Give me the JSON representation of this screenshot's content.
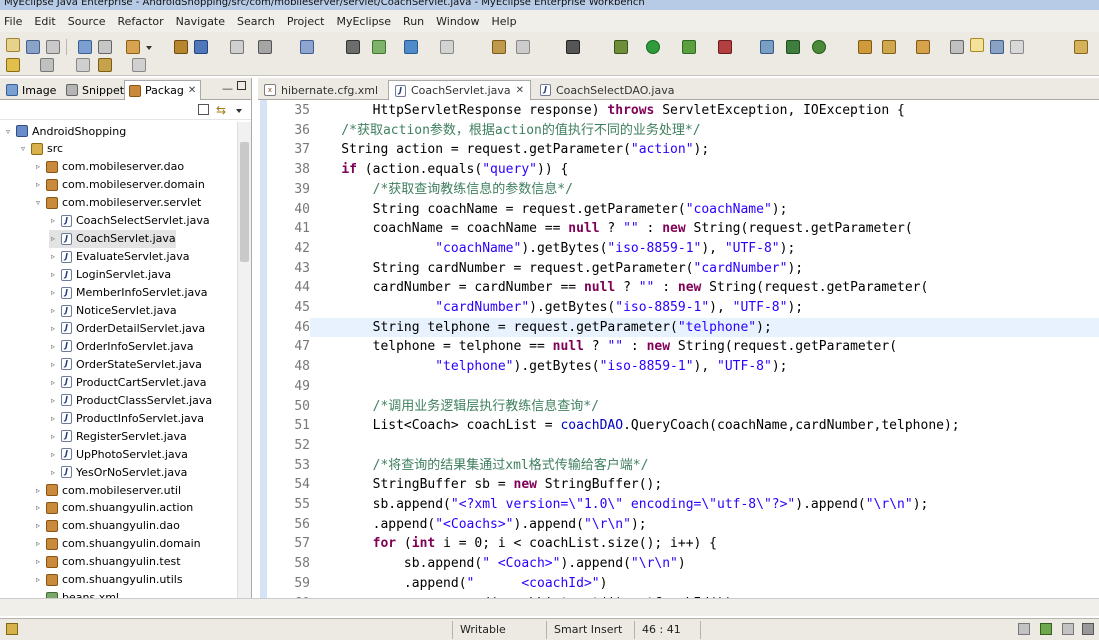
{
  "window": {
    "title": "MyEclipse Java Enterprise - AndroidShopping/src/com/mobileserver/servlet/CoachServlet.java - MyEclipse Enterprise Workbench"
  },
  "menu": [
    "File",
    "Edit",
    "Source",
    "Refactor",
    "Navigate",
    "Search",
    "Project",
    "MyEclipse",
    "Run",
    "Window",
    "Help"
  ],
  "left_tabs": [
    {
      "label": "Image",
      "icon": "image-icon"
    },
    {
      "label": "Snippet",
      "icon": "snippet-icon"
    },
    {
      "label": "Packag",
      "icon": "package-explorer-icon"
    }
  ],
  "tree": [
    {
      "label": "AndroidShopping",
      "kind": "project",
      "indent": 0,
      "twisty": "▿"
    },
    {
      "label": "src",
      "kind": "src",
      "indent": 1,
      "twisty": "▿"
    },
    {
      "label": "com.mobileserver.dao",
      "kind": "pkg",
      "indent": 2,
      "twisty": "▹"
    },
    {
      "label": "com.mobileserver.domain",
      "kind": "pkg",
      "indent": 2,
      "twisty": "▹"
    },
    {
      "label": "com.mobileserver.servlet",
      "kind": "pkg",
      "indent": 2,
      "twisty": "▿"
    },
    {
      "label": "CoachSelectServlet.java",
      "kind": "java",
      "indent": 3,
      "twisty": "▹"
    },
    {
      "label": "CoachServlet.java",
      "kind": "java",
      "indent": 3,
      "twisty": "▹",
      "selected": true
    },
    {
      "label": "EvaluateServlet.java",
      "kind": "java",
      "indent": 3,
      "twisty": "▹"
    },
    {
      "label": "LoginServlet.java",
      "kind": "java",
      "indent": 3,
      "twisty": "▹"
    },
    {
      "label": "MemberInfoServlet.java",
      "kind": "java",
      "indent": 3,
      "twisty": "▹"
    },
    {
      "label": "NoticeServlet.java",
      "kind": "java",
      "indent": 3,
      "twisty": "▹"
    },
    {
      "label": "OrderDetailServlet.java",
      "kind": "java",
      "indent": 3,
      "twisty": "▹"
    },
    {
      "label": "OrderInfoServlet.java",
      "kind": "java",
      "indent": 3,
      "twisty": "▹"
    },
    {
      "label": "OrderStateServlet.java",
      "kind": "java",
      "indent": 3,
      "twisty": "▹"
    },
    {
      "label": "ProductCartServlet.java",
      "kind": "java",
      "indent": 3,
      "twisty": "▹"
    },
    {
      "label": "ProductClassServlet.java",
      "kind": "java",
      "indent": 3,
      "twisty": "▹"
    },
    {
      "label": "ProductInfoServlet.java",
      "kind": "java",
      "indent": 3,
      "twisty": "▹"
    },
    {
      "label": "RegisterServlet.java",
      "kind": "java",
      "indent": 3,
      "twisty": "▹"
    },
    {
      "label": "UpPhotoServlet.java",
      "kind": "java",
      "indent": 3,
      "twisty": "▹"
    },
    {
      "label": "YesOrNoServlet.java",
      "kind": "java",
      "indent": 3,
      "twisty": "▹"
    },
    {
      "label": "com.mobileserver.util",
      "kind": "pkg",
      "indent": 2,
      "twisty": "▹"
    },
    {
      "label": "com.shuangyulin.action",
      "kind": "pkg",
      "indent": 2,
      "twisty": "▹"
    },
    {
      "label": "com.shuangyulin.dao",
      "kind": "pkg",
      "indent": 2,
      "twisty": "▹"
    },
    {
      "label": "com.shuangyulin.domain",
      "kind": "pkg",
      "indent": 2,
      "twisty": "▹"
    },
    {
      "label": "com.shuangyulin.test",
      "kind": "pkg",
      "indent": 2,
      "twisty": "▹"
    },
    {
      "label": "com.shuangyulin.utils",
      "kind": "pkg",
      "indent": 2,
      "twisty": "▹"
    },
    {
      "label": "beans.xml",
      "kind": "xml",
      "indent": 2,
      "twisty": ""
    }
  ],
  "editor_tabs": [
    {
      "label": "hibernate.cfg.xml",
      "icon": "xml-file-icon"
    },
    {
      "label": "CoachServlet.java",
      "icon": "java-file-icon",
      "active": true
    },
    {
      "label": "CoachSelectDAO.java",
      "icon": "java-file-icon"
    }
  ],
  "current_line": 46,
  "code": [
    {
      "n": 35,
      "t": [
        [
          "",
          "        HttpServletResponse response) "
        ],
        [
          "kw",
          "throws"
        ],
        [
          "",
          " ServletException, IOException {"
        ]
      ]
    },
    {
      "n": 36,
      "t": [
        [
          "cm",
          "    /*获取action参数，根据action的值执行不同的业务处理*/"
        ]
      ]
    },
    {
      "n": 37,
      "t": [
        [
          "",
          "    String action = request.getParameter("
        ],
        [
          "str",
          "\"action\""
        ],
        [
          "",
          ");"
        ]
      ]
    },
    {
      "n": 38,
      "t": [
        [
          "",
          "    "
        ],
        [
          "kw",
          "if"
        ],
        [
          "",
          " (action.equals("
        ],
        [
          "str",
          "\"query\""
        ],
        [
          "",
          ")) {"
        ]
      ]
    },
    {
      "n": 39,
      "t": [
        [
          "cm",
          "        /*获取查询教练信息的参数信息*/"
        ]
      ]
    },
    {
      "n": 40,
      "t": [
        [
          "",
          "        String coachName = request.getParameter("
        ],
        [
          "str",
          "\"coachName\""
        ],
        [
          "",
          ");"
        ]
      ]
    },
    {
      "n": 41,
      "t": [
        [
          "",
          "        coachName = coachName == "
        ],
        [
          "kw",
          "null"
        ],
        [
          "",
          " ? "
        ],
        [
          "str",
          "\"\""
        ],
        [
          "",
          " : "
        ],
        [
          "kw",
          "new"
        ],
        [
          "",
          " String(request.getParameter("
        ]
      ]
    },
    {
      "n": 42,
      "t": [
        [
          "",
          "                "
        ],
        [
          "str",
          "\"coachName\""
        ],
        [
          "",
          ").getBytes("
        ],
        [
          "str",
          "\"iso-8859-1\""
        ],
        [
          "",
          "), "
        ],
        [
          "str",
          "\"UTF-8\""
        ],
        [
          "",
          ");"
        ]
      ]
    },
    {
      "n": 43,
      "t": [
        [
          "",
          "        String cardNumber = request.getParameter("
        ],
        [
          "str",
          "\"cardNumber\""
        ],
        [
          "",
          ");"
        ]
      ]
    },
    {
      "n": 44,
      "t": [
        [
          "",
          "        cardNumber = cardNumber == "
        ],
        [
          "kw",
          "null"
        ],
        [
          "",
          " ? "
        ],
        [
          "str",
          "\"\""
        ],
        [
          "",
          " : "
        ],
        [
          "kw",
          "new"
        ],
        [
          "",
          " String(request.getParameter("
        ]
      ]
    },
    {
      "n": 45,
      "t": [
        [
          "",
          "                "
        ],
        [
          "str",
          "\"cardNumber\""
        ],
        [
          "",
          ").getBytes("
        ],
        [
          "str",
          "\"iso-8859-1\""
        ],
        [
          "",
          "), "
        ],
        [
          "str",
          "\"UTF-8\""
        ],
        [
          "",
          ");"
        ]
      ]
    },
    {
      "n": 46,
      "t": [
        [
          "",
          "        String telphone = request.getParameter("
        ],
        [
          "str",
          "\"telphone\""
        ],
        [
          "",
          ");"
        ]
      ]
    },
    {
      "n": 47,
      "t": [
        [
          "",
          "        telphone = telphone == "
        ],
        [
          "kw",
          "null"
        ],
        [
          "",
          " ? "
        ],
        [
          "str",
          "\"\""
        ],
        [
          "",
          " : "
        ],
        [
          "kw",
          "new"
        ],
        [
          "",
          " String(request.getParameter("
        ]
      ]
    },
    {
      "n": 48,
      "t": [
        [
          "",
          "                "
        ],
        [
          "str",
          "\"telphone\""
        ],
        [
          "",
          ").getBytes("
        ],
        [
          "str",
          "\"iso-8859-1\""
        ],
        [
          "",
          "), "
        ],
        [
          "str",
          "\"UTF-8\""
        ],
        [
          "",
          ");"
        ]
      ]
    },
    {
      "n": 49,
      "t": [
        [
          "",
          ""
        ]
      ]
    },
    {
      "n": 50,
      "t": [
        [
          "cm",
          "        /*调用业务逻辑层执行教练信息查询*/"
        ]
      ]
    },
    {
      "n": 51,
      "t": [
        [
          "",
          "        List<Coach> coachList = "
        ],
        [
          "fld",
          "coachDAO"
        ],
        [
          "",
          ".QueryCoach(coachName,cardNumber,telphone);"
        ]
      ]
    },
    {
      "n": 52,
      "t": [
        [
          "",
          ""
        ]
      ]
    },
    {
      "n": 53,
      "t": [
        [
          "cm",
          "        /*将查询的结果集通过xml格式传输给客户端*/"
        ]
      ]
    },
    {
      "n": 54,
      "t": [
        [
          "",
          "        StringBuffer sb = "
        ],
        [
          "kw",
          "new"
        ],
        [
          "",
          " StringBuffer();"
        ]
      ]
    },
    {
      "n": 55,
      "t": [
        [
          "",
          "        sb.append("
        ],
        [
          "str",
          "\"<?xml version=\\\"1.0\\\" encoding=\\\"utf-8\\\"?>\""
        ],
        [
          "",
          ").append("
        ],
        [
          "str",
          "\"\\r\\n\""
        ],
        [
          "",
          ");"
        ]
      ]
    },
    {
      "n": 56,
      "t": [
        [
          "",
          "        .append("
        ],
        [
          "str",
          "\"<Coachs>\""
        ],
        [
          "",
          ").append("
        ],
        [
          "str",
          "\"\\r\\n\""
        ],
        [
          "",
          ");"
        ]
      ]
    },
    {
      "n": 57,
      "t": [
        [
          "",
          "        "
        ],
        [
          "kw",
          "for"
        ],
        [
          "",
          " ("
        ],
        [
          "kw",
          "int"
        ],
        [
          "",
          " i = 0; i < coachList.size(); i++) {"
        ]
      ]
    },
    {
      "n": 58,
      "t": [
        [
          "",
          "            sb.append("
        ],
        [
          "str",
          "\" <Coach>\""
        ],
        [
          "",
          ").append("
        ],
        [
          "str",
          "\"\\r\\n\""
        ],
        [
          "",
          ")"
        ]
      ]
    },
    {
      "n": 59,
      "t": [
        [
          "",
          "            .append("
        ],
        [
          "str",
          "\"      <coachId>\""
        ],
        [
          "",
          ")"
        ]
      ]
    },
    {
      "n": 60,
      "t": [
        [
          "",
          "                .append(coachList.get(i).getCoachId())"
        ]
      ]
    }
  ],
  "status": {
    "writable": "Writable",
    "insert_mode": "Smart Insert",
    "position": "46 : 41"
  }
}
